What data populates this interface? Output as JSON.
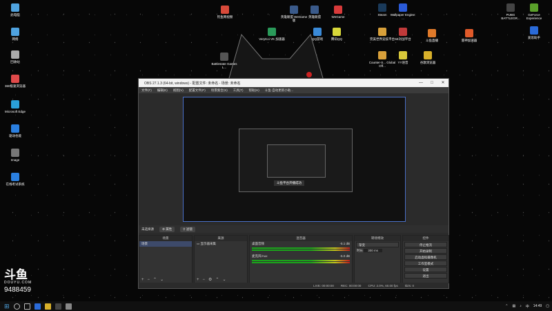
{
  "desktop_icons": [
    {
      "label": "此电脑",
      "color": "#4fa3e0"
    },
    {
      "label": "网络",
      "color": "#4fa3e0"
    },
    {
      "label": "回收站",
      "color": "#aaaaaa"
    },
    {
      "label": "360极速浏览器",
      "color": "#e04a4a"
    },
    {
      "label": "Microsoft Edge",
      "color": "#2aa0d8"
    },
    {
      "label": "驱动也能",
      "color": "#2a7fe0"
    },
    {
      "label": "Image",
      "color": "#777777"
    },
    {
      "label": "在线考试系统",
      "color": "#2a7fe0"
    },
    {
      "label": "钓鱼网视频",
      "color": "#d84a3a"
    },
    {
      "label": "英雄联盟 WeGame版",
      "color": "#3a5a8a"
    },
    {
      "label": "英雄联盟",
      "color": "#3a5a8a"
    },
    {
      "label": "WeGame",
      "color": "#d83a3a"
    },
    {
      "label": "Steam",
      "color": "#1a3a5a"
    },
    {
      "label": "Wallpaper Engine: ...",
      "color": "#2a5ad8"
    },
    {
      "label": "VeryKoi VK 加速器",
      "color": "#2a9a5a"
    },
    {
      "label": "QQ游戏",
      "color": "#3a8ad8"
    },
    {
      "label": "腾讯QQ",
      "color": "#d8d83a"
    },
    {
      "label": "完美世界竞技平台",
      "color": "#d8a03a"
    },
    {
      "label": "5E对战平台",
      "color": "#c03a3a"
    },
    {
      "label": "Battlestate Games L...",
      "color": "#555555"
    },
    {
      "label": "Counter-S... Global Off...",
      "color": "#d8a03a"
    },
    {
      "label": "YY语音",
      "color": "#d8c83a"
    },
    {
      "label": "斗鱼直播",
      "color": "#e07a2a"
    },
    {
      "label": "雷神加速器",
      "color": "#e05a2a"
    },
    {
      "label": "PUBG BATTLEGR...",
      "color": "#444444"
    },
    {
      "label": "GeForce Experience",
      "color": "#5aa02a"
    },
    {
      "label": "爱思助手",
      "color": "#2a6ad8"
    },
    {
      "label": "谷歌浏览器",
      "color": "#d8b02a"
    }
  ],
  "obs": {
    "title": "OBS 27.1.3 (64-bit, windows) - 配置文件: 未命名 - 场景: 未命名",
    "menu": [
      "文件(F)",
      "编辑(E)",
      "视图(V)",
      "配置文件(P)",
      "场景集合(S)",
      "工具(T)",
      "帮助(H)",
      "斗鱼·自动更新小助..."
    ],
    "scene_label": "未选择源",
    "scene_props": "属性",
    "scene_filters": "滤镜",
    "docks": {
      "scenes": {
        "title": "场景",
        "items": [
          "场景"
        ]
      },
      "sources": {
        "title": "来源",
        "items": [
          "显示器采集"
        ]
      },
      "mixer": {
        "title": "混音器",
        "tracks": [
          {
            "name": "桌面音频",
            "level": "-5.1 dB"
          },
          {
            "name": "麦克风/Aux",
            "level": "-5.0 dB"
          }
        ]
      },
      "transitions": {
        "title": "转场特效",
        "type": "渐变",
        "duration_label": "时长",
        "duration": "300 ms"
      },
      "controls": {
        "title": "控件",
        "buttons": [
          "停止推流",
          "开始录制",
          "启动虚拟摄像机",
          "工作室模式",
          "设置",
          "退出"
        ]
      }
    },
    "status": {
      "live": "LIVE: 00:00:00",
      "rec": "REC: 00:00:00",
      "cpu": "CPU: 2.0%, 60.00 fps",
      "kb": "kb/s: 0"
    },
    "preview_toast": "斗鱼平台开播成功"
  },
  "watermark": {
    "logo": "斗鱼",
    "site": "DOUYU.COM",
    "room": "9488459"
  },
  "taskbar": {
    "time": "14:49",
    "ime": "中"
  }
}
